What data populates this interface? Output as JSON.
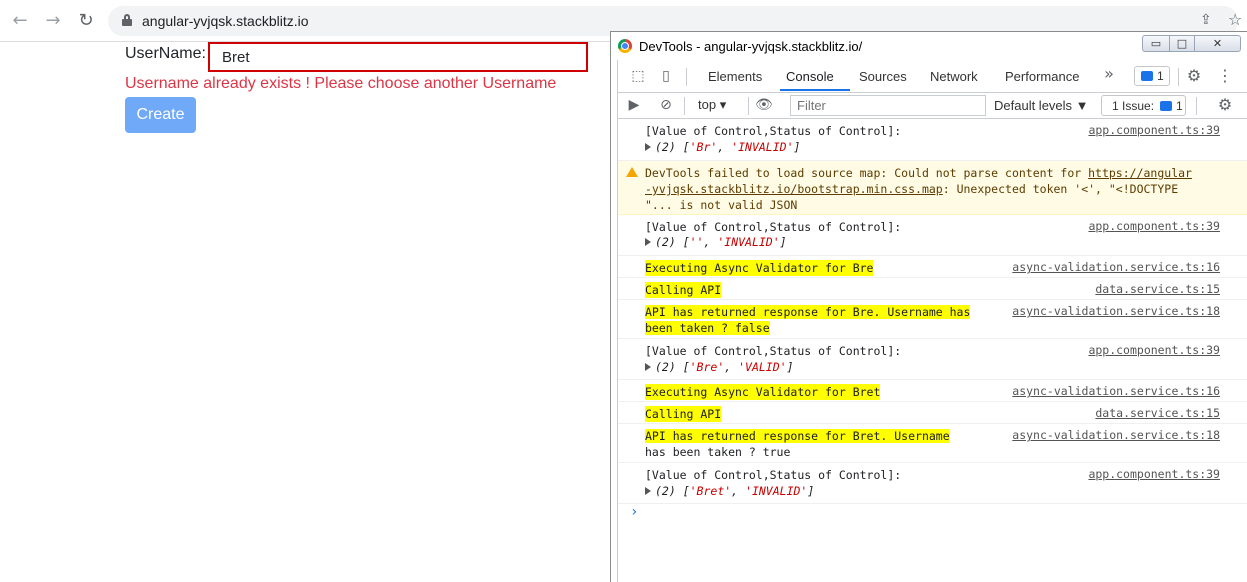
{
  "browser": {
    "back_icon": "←",
    "forward_icon": "→",
    "reload_icon": "↻",
    "url": "angular-yvjqsk.stackblitz.io",
    "share_icon": "⇪",
    "star_icon": "☆"
  },
  "page": {
    "username_label": "UserName:",
    "username_value": "Bret",
    "error_message": "Username already exists ! Please choose another Username",
    "create_button": "Create"
  },
  "devtools": {
    "window_title": "DevTools - angular-yvjqsk.stackblitz.io/",
    "window_buttons": {
      "minimize": "▭",
      "maximize": "□",
      "close": "✕"
    },
    "tabs": [
      "Elements",
      "Console",
      "Sources",
      "Network",
      "Performance"
    ],
    "more_tabs": "»",
    "messages_count": "1",
    "toolbar": {
      "context": "top",
      "filter_placeholder": "Filter",
      "levels": "Default levels ▼",
      "issues_label": "1 Issue:",
      "issues_count": "1"
    },
    "console": [
      {
        "text": "[Value of Control,Status of Control]:",
        "source": "app.component.ts:39",
        "array": "(2) [",
        "items": [
          "'Br'",
          "'INVALID'"
        ]
      },
      {
        "warning": true,
        "line1_pre": "DevTools failed to load source map: Could not parse content for ",
        "link1": "https://angular",
        "line2_link": "-yvjqsk.stackblitz.io/bootstrap.min.css.map",
        "line2_post": ": Unexpected token '<', \"<!DOCTYPE",
        "line3": "\"... is not valid JSON"
      },
      {
        "text": "[Value of Control,Status of Control]:",
        "source": "app.component.ts:39",
        "array": "(2) [",
        "items": [
          "''",
          "'INVALID'"
        ]
      },
      {
        "text": "Executing Async Validator for Bre",
        "source": "async-validation.service.ts:16"
      },
      {
        "text": "Calling API",
        "source": "data.service.ts:15"
      },
      {
        "text1": "API has returned response for Bre. Username has",
        "text2": "been taken ? false",
        "source": "async-validation.service.ts:18"
      },
      {
        "text": "[Value of Control,Status of Control]:",
        "source": "app.component.ts:39",
        "array": "(2) [",
        "items": [
          "'Bre'",
          "'VALID'"
        ]
      },
      {
        "text": "Executing Async Validator for Bret",
        "source": "async-validation.service.ts:16"
      },
      {
        "text": "Calling API",
        "source": "data.service.ts:15"
      },
      {
        "text1": "API has returned response for Bret. Username",
        "text2": "has been taken ? true",
        "source": "async-validation.service.ts:18"
      },
      {
        "text": "[Value of Control,Status of Control]:",
        "source": "app.component.ts:39",
        "array": "(2) [",
        "items": [
          "'Bret'",
          "'INVALID'"
        ]
      }
    ],
    "prompt": "›"
  },
  "colors": {
    "error": "#dc3545",
    "input_border": "#d00000",
    "button": "#6fa9f7",
    "highlight": "#ffff00",
    "accent": "#1a73e8"
  }
}
